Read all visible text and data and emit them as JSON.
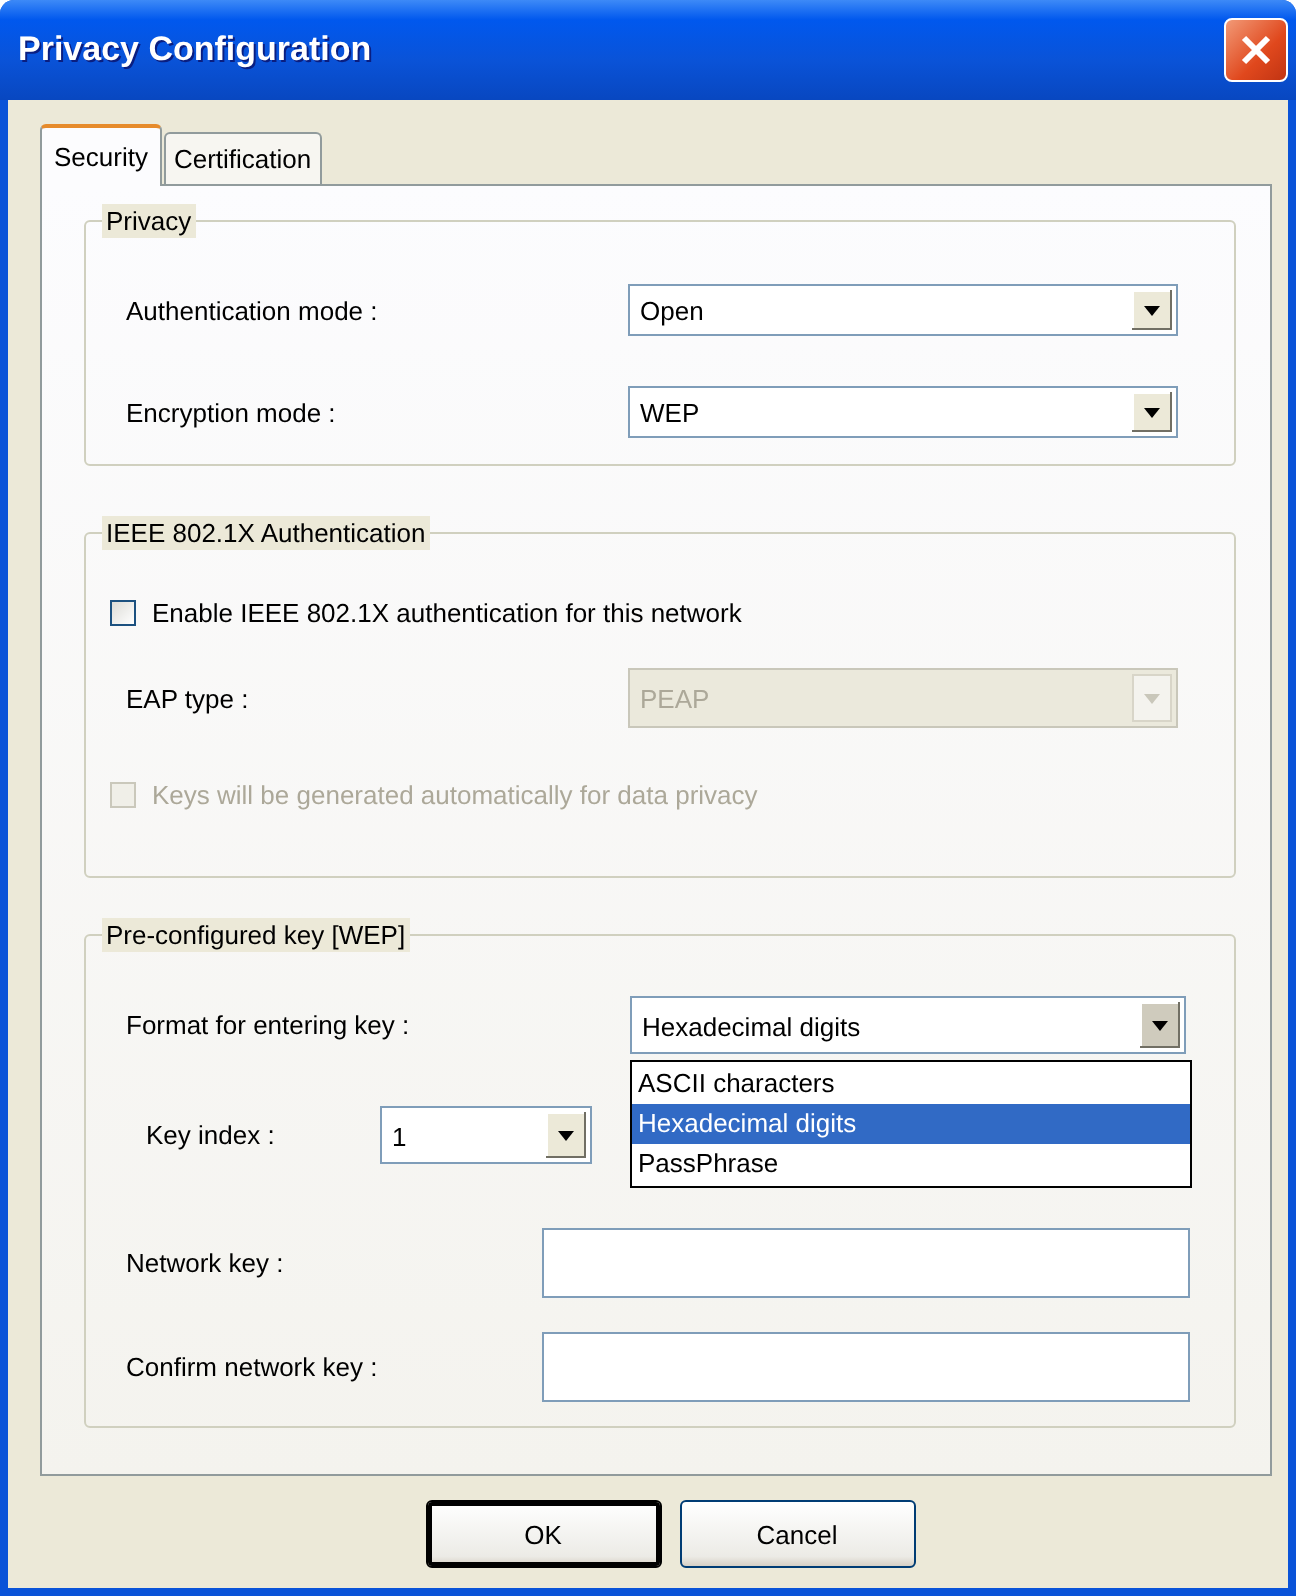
{
  "window": {
    "title": "Privacy Configuration"
  },
  "tabs": [
    {
      "label": "Security",
      "selected": true
    },
    {
      "label": "Certification",
      "selected": false
    }
  ],
  "privacy": {
    "title": "Privacy",
    "fields": [
      {
        "label": "Authentication mode :",
        "value": "Open"
      },
      {
        "label": "Encryption mode :",
        "value": "WEP"
      }
    ]
  },
  "ieee8021x": {
    "title": "IEEE 802.1X Authentication",
    "enable": {
      "label": "Enable IEEE 802.1X authentication for this network",
      "checked": false,
      "disabled": false
    },
    "eap_type": {
      "label": "EAP type :",
      "value": "PEAP",
      "disabled": true
    },
    "keys_auto": {
      "label": "Keys will be generated automatically for data privacy",
      "checked": false,
      "disabled": true
    }
  },
  "preconfigured_key": {
    "title": "Pre-configured key [WEP]",
    "format": {
      "label": "Format for entering key :",
      "value": "Hexadecimal digits",
      "expanded": true,
      "options": [
        {
          "label": "ASCII characters",
          "selected": false
        },
        {
          "label": "Hexadecimal digits",
          "selected": true
        },
        {
          "label": "PassPhrase",
          "selected": false
        }
      ]
    },
    "key_index": {
      "label": "Key index :",
      "value": "1"
    },
    "network_key": {
      "label": "Network key :"
    },
    "confirm_key": {
      "label": "Confirm network key :"
    }
  },
  "buttons": [
    {
      "label": "OK",
      "default": true
    },
    {
      "label": "Cancel",
      "default": false
    }
  ]
}
